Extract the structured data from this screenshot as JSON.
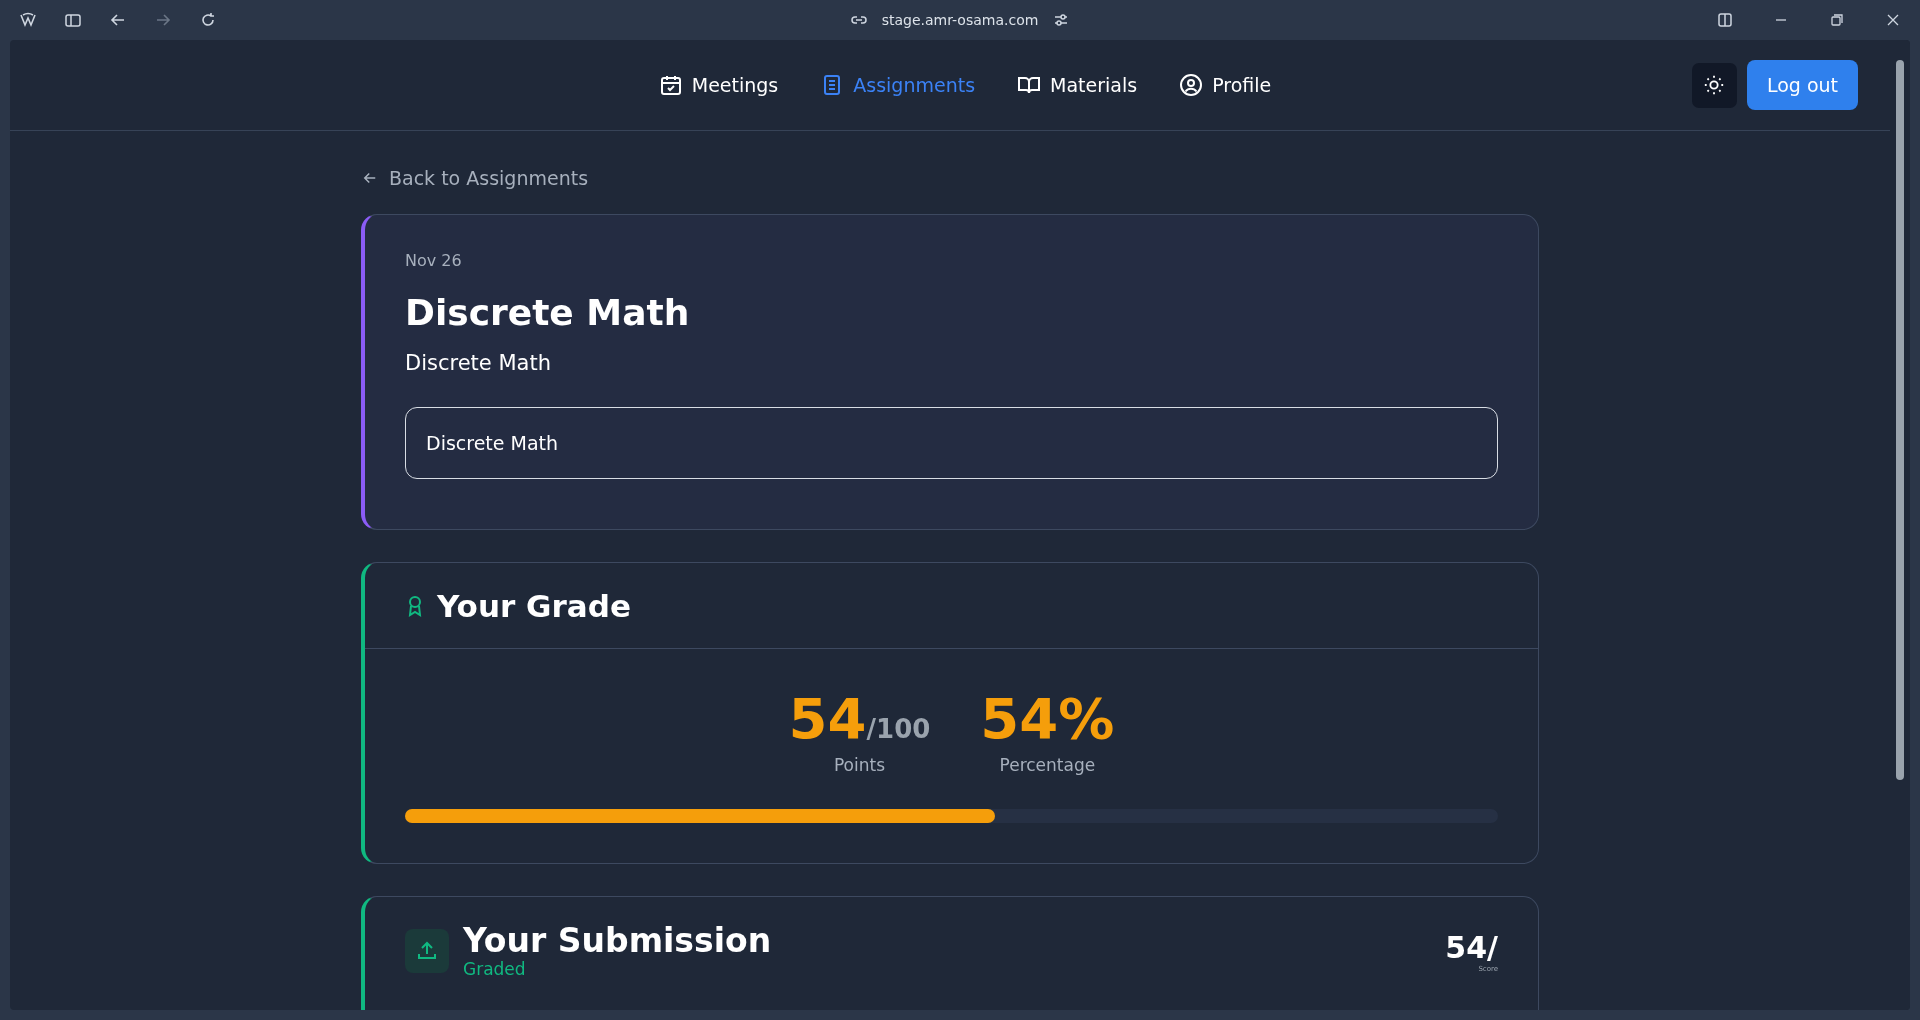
{
  "browser": {
    "url": "stage.amr-osama.com"
  },
  "nav": {
    "items": [
      {
        "label": "Meetings",
        "selected": false
      },
      {
        "label": "Assignments",
        "selected": true
      },
      {
        "label": "Materials",
        "selected": false
      },
      {
        "label": "Profile",
        "selected": false
      }
    ],
    "logout": "Log out"
  },
  "back_link": "Back to Assignments",
  "assignment": {
    "date": "Nov 26",
    "title": "Discrete Math",
    "subtitle": "Discrete Math",
    "description": "Discrete Math"
  },
  "grade": {
    "title": "Your Grade",
    "points": "54",
    "total": "/100",
    "points_label": "Points",
    "percentage": "54%",
    "percentage_label": "Percentage",
    "level": 0.54
  },
  "submission": {
    "title": "Your Submission",
    "status": "Graded",
    "score": "54/",
    "score_label": "Score"
  }
}
